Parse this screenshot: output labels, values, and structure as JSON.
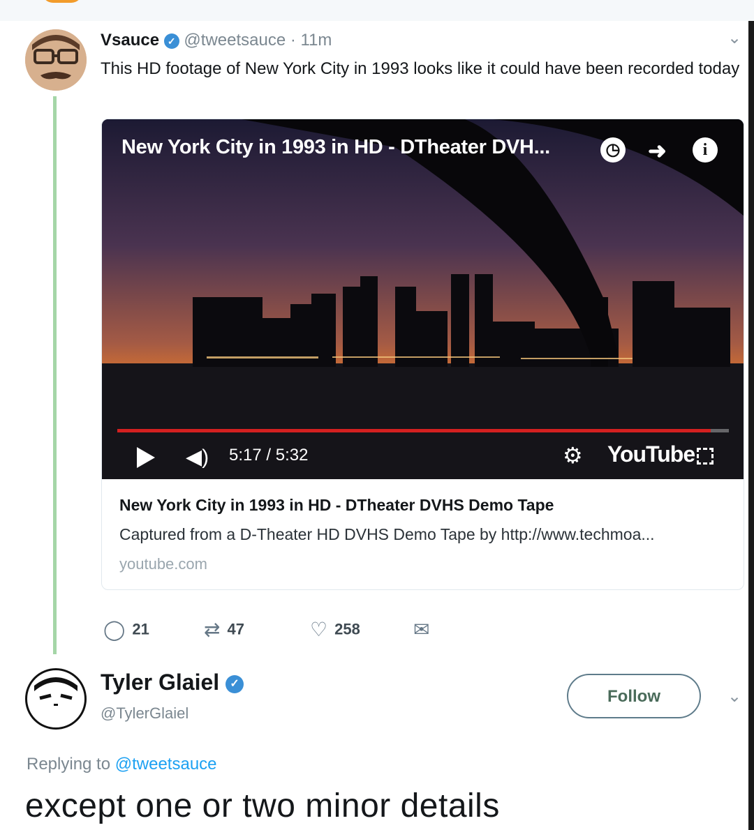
{
  "tweet": {
    "author_name": "Vsauce",
    "handle": "@tweetsauce",
    "time": "· 11m",
    "text": "This HD footage of New York City in 1993 looks like it could have been recorded today",
    "card": {
      "video_title": "New York City in 1993 in HD - DTheater DVH...",
      "time_display": "5:17 / 5:32",
      "progress": 0.97,
      "player_logo": "YouTube",
      "title": "New York City in 1993 in HD - DTheater DVHS Demo Tape",
      "description": "Captured from a D-Theater HD DVHS Demo Tape by http://www.techmoa...",
      "domain": "youtube.com"
    },
    "actions": {
      "replies": "21",
      "retweets": "47",
      "likes": "258"
    }
  },
  "reply": {
    "author_name": "Tyler Glaiel",
    "handle": "@TylerGlaiel",
    "follow_label": "Follow",
    "replying_prefix": "Replying to",
    "replying_to": "@tweetsauce",
    "text": "except one or two minor details"
  },
  "icons": {
    "verified": "verified-badge-icon",
    "chevron": "chevron-down-icon",
    "watch_later": "clock-icon",
    "share": "share-arrow-icon",
    "info": "info-icon",
    "play": "play-icon",
    "volume": "volume-icon",
    "settings": "gear-hd-icon",
    "fullscreen": "fullscreen-icon",
    "reply": "reply-bubble-icon",
    "retweet": "retweet-icon",
    "like": "heart-icon",
    "dm": "envelope-icon"
  },
  "colors": {
    "accent": "#1da1f2",
    "verified": "#3a8fd6",
    "progress": "#d32020",
    "thread_line": "#a5d6a7"
  }
}
